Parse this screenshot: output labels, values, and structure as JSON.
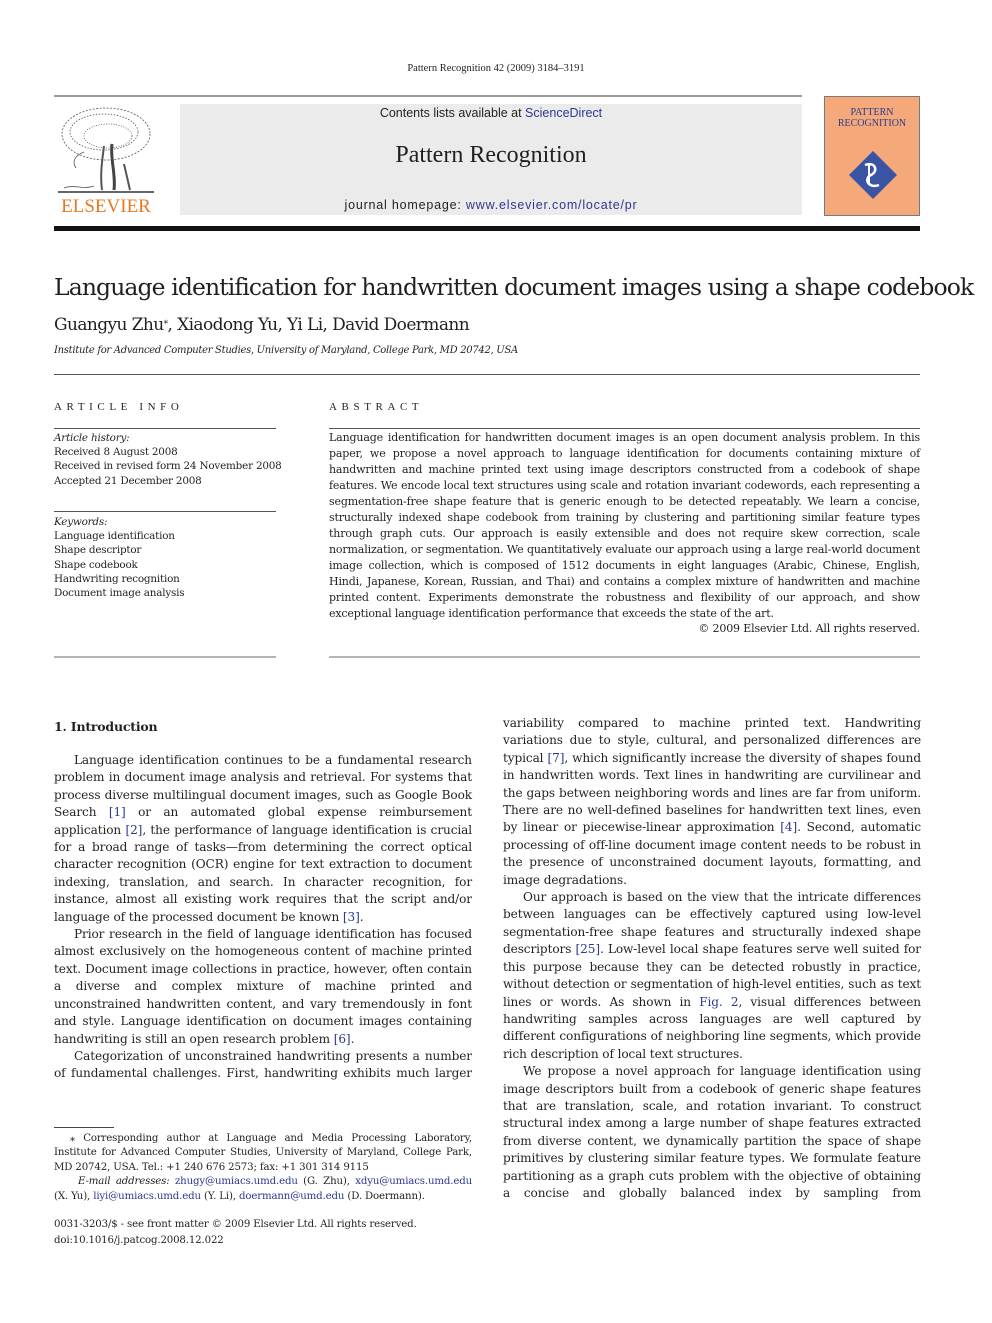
{
  "running_head": "Pattern Recognition 42 (2009) 3184–3191",
  "masthead": {
    "publisher_logo_text": "ELSEVIER",
    "contents_prefix": "Contents lists available at ",
    "contents_link": "ScienceDirect",
    "journal_title": "Pattern Recognition",
    "homepage_prefix": "journal homepage: ",
    "homepage_link": "www.elsevier.com/locate/pr",
    "cover_title_line1": "PATTERN",
    "cover_title_line2": "RECOGNITION",
    "colors": {
      "elsevier_orange": "#e87722",
      "link_blue": "#2b3990",
      "cover_bg": "#f5a97a",
      "cover_diamond": "#3a54a4"
    }
  },
  "article": {
    "title": "Language identification for handwritten document images using a shape codebook",
    "authors": [
      {
        "name": "Guangyu Zhu",
        "mark": "⁎"
      },
      {
        "name": "Xiaodong Yu",
        "mark": ""
      },
      {
        "name": "Yi Li",
        "mark": ""
      },
      {
        "name": "David Doermann",
        "mark": ""
      }
    ],
    "affiliation": "Institute for Advanced Computer Studies, University of Maryland, College Park, MD 20742, USA"
  },
  "article_info": {
    "heading": "ARTICLE INFO",
    "history_label": "Article history:",
    "history": [
      "Received 8 August 2008",
      "Received in revised form 24 November 2008",
      "Accepted 21 December 2008"
    ],
    "keywords_label": "Keywords:",
    "keywords": [
      "Language identification",
      "Shape descriptor",
      "Shape codebook",
      "Handwriting recognition",
      "Document image analysis"
    ]
  },
  "abstract": {
    "heading": "ABSTRACT",
    "text": "Language identification for handwritten document images is an open document analysis problem. In this paper, we propose a novel approach to language identification for documents containing mixture of handwritten and machine printed text using image descriptors constructed from a codebook of shape features. We encode local text structures using scale and rotation invariant codewords, each representing a segmentation-free shape feature that is generic enough to be detected repeatably. We learn a concise, structurally indexed shape codebook from training by clustering and partitioning similar feature types through graph cuts. Our approach is easily extensible and does not require skew correction, scale normalization, or segmentation. We quantitatively evaluate our approach using a large real-world document image collection, which is composed of 1512 documents in eight languages (Arabic, Chinese, English, Hindi, Japanese, Korean, Russian, and Thai) and contains a complex mixture of handwritten and machine printed content. Experiments demonstrate the robustness and flexibility of our approach, and show exceptional language identification performance that exceeds the state of the art.",
    "copyright": "© 2009 Elsevier Ltd. All rights reserved."
  },
  "body": {
    "section_heading": "1.  Introduction",
    "p1": {
      "a": "Language identification continues to be a fundamental research problem in document image analysis and retrieval. For systems that process diverse multilingual document images, such as Google Book Search ",
      "ref1": "[1]",
      "b": " or an automated global expense reimbursement application ",
      "ref2": "[2]",
      "c": ", the performance of language identification is crucial for a broad range of tasks—from determining the correct optical character recognition (OCR) engine for text extraction to document indexing, translation, and search. In character recognition, for instance, almost all existing work requires that the script and/or language of the processed document be known ",
      "ref3": "[3]",
      "d": "."
    },
    "p2": {
      "a": "Prior research in the field of language identification has focused almost exclusively on the homogeneous content of machine printed text. Document image collections in practice, however, often contain a diverse and complex mixture of machine printed and unconstrained handwritten content, and vary tremendously in font and style. Language identification on document images containing handwriting is still an open research problem ",
      "ref": "[6]",
      "b": "."
    },
    "p3": {
      "a": "Categorization of unconstrained handwriting presents a number of fundamental challenges. First, handwriting exhibits much larger"
    },
    "p3_cont": {
      "a": "variability compared to machine printed text. Handwriting variations due to style, cultural, and personalized differences are typical ",
      "ref1": "[7]",
      "b": ", which significantly increase the diversity of shapes found in handwritten words. Text lines in handwriting are curvilinear and the gaps between neighboring words and lines are far from uniform. There are no well-defined baselines for handwritten text lines, even by linear or piecewise-linear approximation ",
      "ref2": "[4]",
      "c": ". Second, automatic processing of off-line document image content needs to be robust in the presence of unconstrained document layouts, formatting, and image degradations."
    },
    "p4": {
      "a": "Our approach is based on the view that the intricate differences between languages can be effectively captured using low-level segmentation-free shape features and structurally indexed shape descriptors ",
      "ref1": "[25]",
      "b": ". Low-level local shape features serve well suited for this purpose because they can be detected robustly in practice, without detection or segmentation of high-level entities, such as text lines or words. As shown in ",
      "ref2": "Fig. 2",
      "c": ", visual differences between handwriting samples across languages are well captured by different configurations of neighboring line segments, which provide rich description of local text structures."
    },
    "p5": {
      "a": "We propose a novel approach for language identification using image descriptors built from a codebook of generic shape features that are translation, scale, and rotation invariant. To construct structural index among a large number of shape features extracted from diverse content, we dynamically partition the space of shape primitives by clustering similar feature types. We formulate feature partitioning as a graph cuts problem with the objective of obtaining a concise and globally balanced index by sampling from"
    }
  },
  "footnotes": {
    "corresponding": "⁎ Corresponding author at Language and Media Processing Laboratory, Institute for Advanced Computer Studies, University of Maryland, College Park, MD 20742, USA. Tel.: +1 240 676 2573; fax: +1 301 314 9115",
    "email_label": "E-mail addresses:",
    "emails": [
      {
        "address": "zhugy@umiacs.umd.edu",
        "who": " (G. Zhu), "
      },
      {
        "address": "xdyu@umiacs.umd.edu",
        "who": " (X. Yu), "
      },
      {
        "address": "liyi@umiacs.umd.edu",
        "who": " (Y. Li), "
      },
      {
        "address": "doermann@umd.edu",
        "who": " (D. Doermann)."
      }
    ],
    "front_matter": "0031-3203/$ - see front matter © 2009 Elsevier Ltd. All rights reserved.",
    "doi": "doi:10.1016/j.patcog.2008.12.022"
  }
}
